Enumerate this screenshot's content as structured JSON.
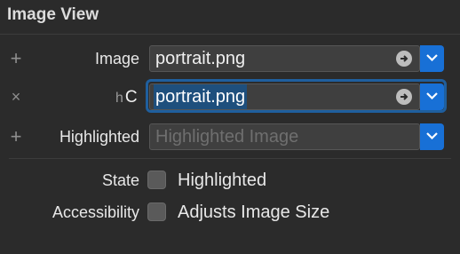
{
  "section": {
    "title": "Image View"
  },
  "rows": [
    {
      "lead": "+",
      "label": "Image",
      "value": "portrait.png"
    },
    {
      "lead": "×",
      "prefix_h": "h",
      "prefix_c": "C",
      "value": "portrait.png"
    },
    {
      "lead": "+",
      "label": "Highlighted",
      "placeholder": "Highlighted Image"
    }
  ],
  "checks": [
    {
      "label": "State",
      "text": "Highlighted",
      "checked": false
    },
    {
      "label": "Accessibility",
      "text": "Adjusts Image Size",
      "checked": false
    }
  ],
  "colors": {
    "accent": "#1870d6",
    "background": "#2b2b2b",
    "focus": "#1f5f9e"
  },
  "icons": {
    "go": "arrow-right-circle-icon",
    "dropdown": "chevron-down-icon"
  }
}
